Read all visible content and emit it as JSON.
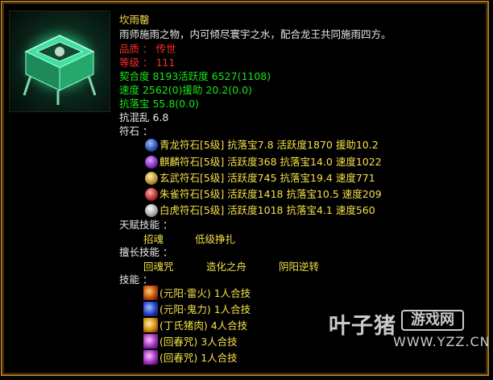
{
  "item": {
    "name": "坎雨罄",
    "desc": "雨师施雨之物，内可倾尽寰宇之水，配合龙王共同施雨四方。",
    "quality": "品质 ： 传世",
    "level": "等级 ： 111"
  },
  "stats": {
    "row1": "契合度       8193活跃度  6527(1108)",
    "row2": "速度        2562(0)援助      20.2(0.0)",
    "row3": "抗落宝     55.8(0.0)",
    "row4": "抗混乱 6.8"
  },
  "runes": {
    "header": "符石 ：",
    "items": [
      {
        "text": "青龙符石[5级] 抗落宝7.8 活跃度1870 援助10.2",
        "icon": "blue-dragon-rune-icon",
        "color": "#3a6ad8"
      },
      {
        "text": "麒麟符石[5级] 活跃度368 抗落宝14.0 速度1022",
        "icon": "qilin-rune-icon",
        "color": "#8a3ad0"
      },
      {
        "text": "玄武符石[5级] 活跃度745 抗落宝19.4 速度771",
        "icon": "black-tortoise-rune-icon",
        "color": "#c8a040"
      },
      {
        "text": "朱雀符石[5级] 活跃度1418 抗落宝10.5 速度209",
        "icon": "vermilion-bird-rune-icon",
        "color": "#d03a3a"
      },
      {
        "text": "白虎符石[5级] 活跃度1018 抗落宝4.1 速度560",
        "icon": "white-tiger-rune-icon",
        "color": "#d8d8d8"
      }
    ]
  },
  "talent": {
    "header": "天赋技能 ：",
    "skills": [
      "招魂",
      "低级挣扎"
    ]
  },
  "special": {
    "header": "擅长技能 ：",
    "skills": [
      "回魂咒",
      "造化之舟",
      "阴阳逆转"
    ]
  },
  "skills": {
    "header": "技能 ：",
    "items": [
      {
        "text": "(元阳·雷火) 1人合技",
        "icon": "thunder-fire-skill-icon",
        "color": "#e06a20"
      },
      {
        "text": "(元阳·鬼力) 1人合技",
        "icon": "ghost-power-skill-icon",
        "color": "#3050d0"
      },
      {
        "text": "(丁氏猪肉) 4人合技",
        "icon": "pork-skill-icon",
        "color": "#e0a020"
      },
      {
        "text": "(回春咒) 3人合技",
        "icon": "revive-skill-icon-1",
        "color": "#c040d0"
      },
      {
        "text": "(回春咒) 1人合技",
        "icon": "revive-skill-icon-2",
        "color": "#c040d0"
      }
    ]
  },
  "watermark": {
    "main": "叶子猪",
    "box": "游戏网",
    "url": "WWW.YZZ.CN"
  }
}
